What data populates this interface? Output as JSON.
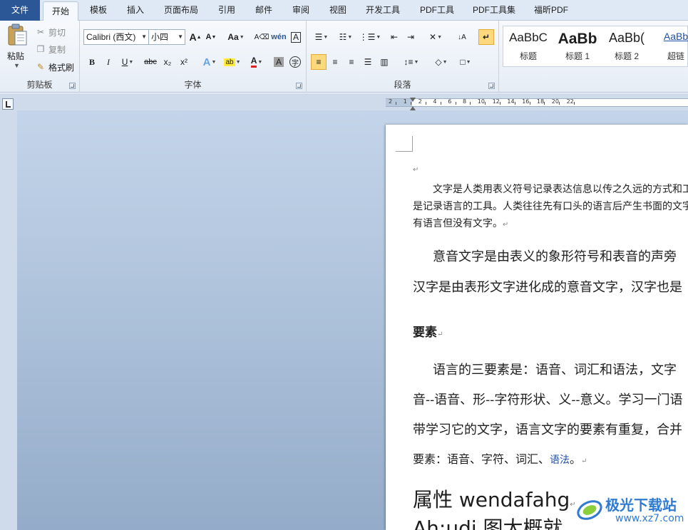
{
  "tabs": {
    "file": "文件",
    "items": [
      "开始",
      "模板",
      "插入",
      "页面布局",
      "引用",
      "邮件",
      "审阅",
      "视图",
      "开发工具",
      "PDF工具",
      "PDF工具集",
      "福昕PDF"
    ]
  },
  "clipboard": {
    "paste": "粘贴",
    "cut": "剪切",
    "copy": "复制",
    "format_painter": "格式刷",
    "group_label": "剪贴板"
  },
  "font": {
    "font_name": "Calibri (西文)",
    "font_size": "小四",
    "group_label": "字体",
    "grow_label": "A",
    "shrink_label": "A",
    "case_label": "Aa",
    "bold": "B",
    "italic": "I",
    "underline": "U",
    "strike": "abc",
    "subscript": "x₂",
    "superscript": "x²",
    "font_color_label": "A",
    "char_shading_label": "A"
  },
  "paragraph": {
    "group_label": "段落"
  },
  "styles": {
    "items": [
      {
        "sample": "AaBbC",
        "name": "标题"
      },
      {
        "sample": "AaBb",
        "name": "标题 1"
      },
      {
        "sample": "AaBb(",
        "name": "标题 2"
      },
      {
        "sample": "AaBb",
        "name": "超链"
      }
    ]
  },
  "ruler": {
    "labels": [
      "2",
      "1",
      "2",
      "4",
      "6",
      "8",
      "10",
      "12",
      "14",
      "16",
      "18",
      "20",
      "22"
    ]
  },
  "document": {
    "para1_line1": "文字是人类用表义符号记录表达信息以传之久远的方式和工",
    "para1_line2": "是记录语言的工具。人类往往先有口头的语言后产生书面的文字",
    "para1_line3": "有语言但没有文字。",
    "para2_line1": "意音文字是由表义的象形符号和表音的声旁",
    "para2_line2": "汉字是由表形文字进化成的意音文字，汉字也是",
    "heading": "要素",
    "para3_line1": "语言的三要素是：语音、词汇和语法，文字",
    "para3_line2": "音--语音、形--字符形状、义--意义。学习一门语",
    "para3_line3": "带学习它的文字，语言文字的要素有重复，合并",
    "para3_line4_a": "要素：语音、字符、词汇、",
    "para3_line4_b": "语法",
    "para3_line4_c": "。",
    "big_line1": "属性 wendafahg",
    "big_line2": "Ah;udi 图太概就"
  },
  "watermark": {
    "text": "极光下载站",
    "url": "www.xz7.com"
  }
}
